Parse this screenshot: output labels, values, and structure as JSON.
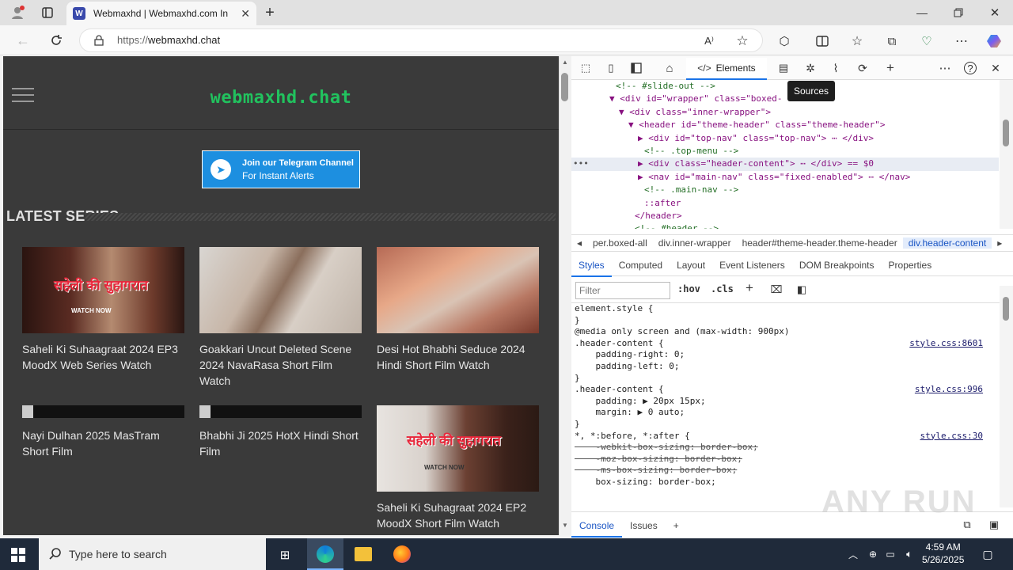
{
  "browser": {
    "tab_title": "Webmaxhd | Webmaxhd.com In",
    "favicon": "W",
    "url_scheme": "https://",
    "url_host": "webmaxhd.chat",
    "new_tab_label": "+"
  },
  "page": {
    "logo": "webmaxhd.chat",
    "telegram_line1": "Join our Telegram Channel",
    "telegram_line2": "For Instant Alerts",
    "section_title": "LATEST SERIES",
    "cards": [
      {
        "title": "Saheli Ki Suhaagraat 2024 EP3 MoodX Web Series Watch",
        "thumb": "poster",
        "thumb_text": "सहेली की सुहागरात",
        "thumb_sub": "WATCH NOW"
      },
      {
        "title": "Goakkari Uncut Deleted Scene 2024 NavaRasa Short Film Watch",
        "thumb": "photo"
      },
      {
        "title": "Desi Hot Bhabhi Seduce 2024 Hindi Short Film Watch",
        "thumb": "photo"
      },
      {
        "title": "Nayi Dulhan 2025 MasTram Short Film",
        "thumb": "broken"
      },
      {
        "title": "Bhabhi Ji 2025 HotX Hindi Short Film",
        "thumb": "broken"
      },
      {
        "title": "Saheli Ki Suhagraat 2024 EP2 MoodX Short Film Watch",
        "thumb": "poster",
        "thumb_text": "सहेली की सुहागरात",
        "thumb_sub": "WATCH NOW"
      }
    ]
  },
  "devtools": {
    "active_tab": "Elements",
    "tooltip": "Sources",
    "dom_lines": [
      {
        "indent": 56,
        "text": "<!-- #slide-out -->",
        "kind": "comment"
      },
      {
        "indent": 48,
        "text": "▼ <div id=\"wrapper\" class=\"boxed-",
        "kind": "tag"
      },
      {
        "indent": 60,
        "text": "▼ <div class=\"inner-wrapper\">",
        "kind": "tag"
      },
      {
        "indent": 72,
        "text": "▼ <header id=\"theme-header\" class=\"theme-header\">",
        "kind": "tag"
      },
      {
        "indent": 84,
        "text": "▶ <div id=\"top-nav\" class=\"top-nav\"> ⋯ </div>",
        "kind": "tag"
      },
      {
        "indent": 92,
        "text": "<!-- .top-menu -->",
        "kind": "comment"
      },
      {
        "indent": 84,
        "text": "▶ <div class=\"header-content\"> ⋯ </div> == $0",
        "kind": "tag",
        "selected": true
      },
      {
        "indent": 84,
        "text": "▶ <nav id=\"main-nav\" class=\"fixed-enabled\"> ⋯ </nav>",
        "kind": "tag"
      },
      {
        "indent": 92,
        "text": "<!-- .main-nav -->",
        "kind": "comment"
      },
      {
        "indent": 92,
        "text": "::after",
        "kind": "pseudo"
      },
      {
        "indent": 80,
        "text": "</header>",
        "kind": "tag"
      },
      {
        "indent": 80,
        "text": "<!-- #header -->",
        "kind": "comment"
      }
    ],
    "crumbs": [
      "◂",
      "per.boxed-all",
      "div.inner-wrapper",
      "header#theme-header.theme-header",
      "div.header-content",
      "▸"
    ],
    "style_tabs": [
      "Styles",
      "Computed",
      "Layout",
      "Event Listeners",
      "DOM Breakpoints",
      "Properties"
    ],
    "filter_placeholder": "Filter",
    "filter_buttons": [
      ":hov",
      ".cls",
      "+"
    ],
    "css_lines": [
      {
        "text": "element.style {",
        "src": ""
      },
      {
        "text": "}",
        "src": ""
      },
      {
        "text": "@media only screen and (max-width: 900px)",
        "src": ""
      },
      {
        "text": ".header-content {",
        "src": "style.css:8601"
      },
      {
        "text": "    padding-right: 0;",
        "src": ""
      },
      {
        "text": "    padding-left: 0;",
        "src": ""
      },
      {
        "text": "}",
        "src": ""
      },
      {
        "text": ".header-content {",
        "src": "style.css:996"
      },
      {
        "text": "    padding: ▶ 20px 15px;",
        "src": ""
      },
      {
        "text": "    margin: ▶ 0 auto;",
        "src": ""
      },
      {
        "text": "}",
        "src": ""
      },
      {
        "text": "*, *:before, *:after {",
        "src": "style.css:30"
      },
      {
        "text": "    -webkit-box-sizing: border-box;",
        "src": "",
        "strike": true
      },
      {
        "text": "    -moz-box-sizing: border-box;",
        "src": "",
        "strike": true
      },
      {
        "text": "    -ms-box-sizing: border-box;",
        "src": "",
        "strike": true
      },
      {
        "text": "    box-sizing: border-box;",
        "src": ""
      }
    ],
    "drawer_tabs": [
      "Console",
      "Issues",
      "+"
    ]
  },
  "taskbar": {
    "search_placeholder": "Type here to search",
    "time": "4:59 AM",
    "date": "5/26/2025"
  },
  "watermark": "ANY RUN"
}
